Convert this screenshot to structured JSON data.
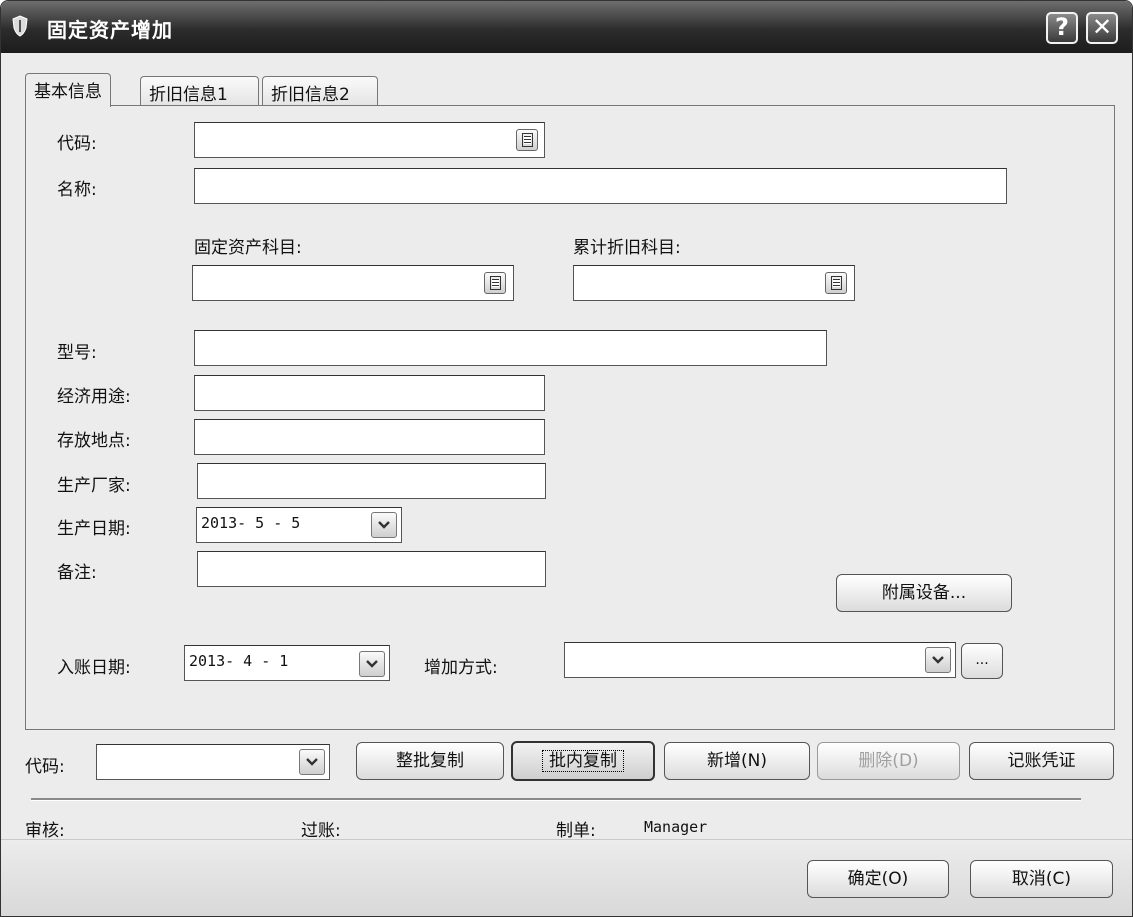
{
  "window": {
    "title": "固定资产增加",
    "help_label": "?",
    "close_label": "✕"
  },
  "tabs": [
    {
      "label": "基本信息",
      "active": true
    },
    {
      "label": "折旧信息1",
      "active": false
    },
    {
      "label": "折旧信息2",
      "active": false
    }
  ],
  "form": {
    "code_label": "代码:",
    "code_value": "",
    "name_label": "名称:",
    "name_value": "",
    "asset_account_label": "固定资产科目:",
    "asset_account_value": "",
    "depreciation_account_label": "累计折旧科目:",
    "depreciation_account_value": "",
    "model_label": "型号:",
    "model_value": "",
    "purpose_label": "经济用途:",
    "purpose_value": "",
    "location_label": "存放地点:",
    "location_value": "",
    "manufacturer_label": "生产厂家:",
    "manufacturer_value": "",
    "production_date_label": "生产日期:",
    "production_date_value": "2013- 5 - 5",
    "notes_label": "备注:",
    "notes_value": "",
    "accessories_button": "附属设备...",
    "entry_date_label": "入账日期:",
    "entry_date_value": "2013- 4 - 1",
    "increase_method_label": "增加方式:",
    "increase_method_value": "",
    "ellipsis_button": "..."
  },
  "toolbar": {
    "code_label": "代码:",
    "code_value": "",
    "batch_copy": "整批复制",
    "inbatch_copy": "批内复制",
    "add_new": "新增(N)",
    "delete": "删除(D)",
    "voucher": "记账凭证"
  },
  "status": {
    "audit_label": "审核:",
    "post_label": "过账:",
    "maker_label": "制单:",
    "maker_value": "Manager"
  },
  "footer": {
    "ok": "确定(O)",
    "cancel": "取消(C)"
  }
}
